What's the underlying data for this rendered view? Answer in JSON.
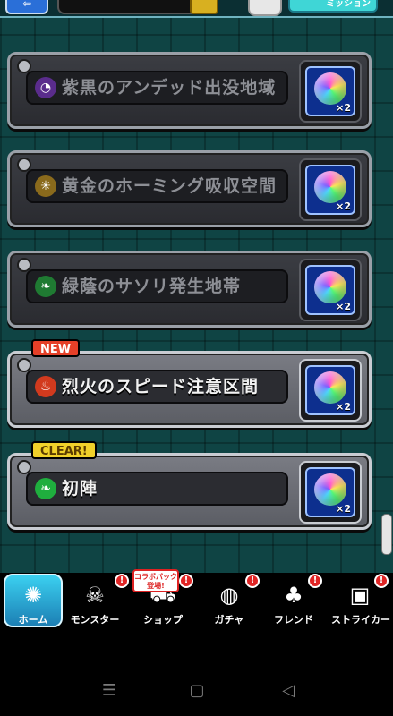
{
  "header": {
    "back_label": "⇦",
    "info_label": "!",
    "mission_label": "ミッション"
  },
  "quests": [
    {
      "name": "紫黒のアンデッド出没地域",
      "emblem": "swirl-icon",
      "emblem_color": "#5a2c8c",
      "reward_count": "×2",
      "status": "locked",
      "badge": ""
    },
    {
      "name": "黄金のホーミング吸収空間",
      "emblem": "gear-icon",
      "emblem_color": "#8a6a1c",
      "reward_count": "×2",
      "status": "locked",
      "badge": ""
    },
    {
      "name": "緑蔭のサソリ発生地帯",
      "emblem": "leaf-icon",
      "emblem_color": "#1f7a32",
      "reward_count": "×2",
      "status": "locked",
      "badge": ""
    },
    {
      "name": "烈火のスピード注意区間",
      "emblem": "flame-icon",
      "emblem_color": "#d23a1e",
      "reward_count": "×2",
      "status": "active",
      "badge": "NEW"
    },
    {
      "name": "初陣",
      "emblem": "leaf-icon",
      "emblem_color": "#1fae3e",
      "reward_count": "×2",
      "status": "active",
      "badge": "CLEAR!"
    }
  ],
  "tabs": [
    {
      "label": "ホーム",
      "icon": "home-icon",
      "active": true,
      "alert": false
    },
    {
      "label": "モンスター",
      "icon": "monster-icon",
      "active": false,
      "alert": true
    },
    {
      "label": "ショップ",
      "icon": "cart-icon",
      "active": false,
      "alert": true
    },
    {
      "label": "ガチャ",
      "icon": "egg-icon",
      "active": false,
      "alert": true
    },
    {
      "label": "フレンド",
      "icon": "friends-icon",
      "active": false,
      "alert": true
    },
    {
      "label": "ストライカー",
      "icon": "profile-card-icon",
      "active": false,
      "alert": true
    }
  ],
  "promo": {
    "line1": "コラボパック",
    "line2": "登場!"
  },
  "alert_text": "!",
  "system_nav": {
    "recent": "☰",
    "home": "▢",
    "back": "◁"
  },
  "colors": {
    "reward_bg": "#0d2f8e",
    "active_tab": "#3bd0f0",
    "alert": "#e02525"
  }
}
